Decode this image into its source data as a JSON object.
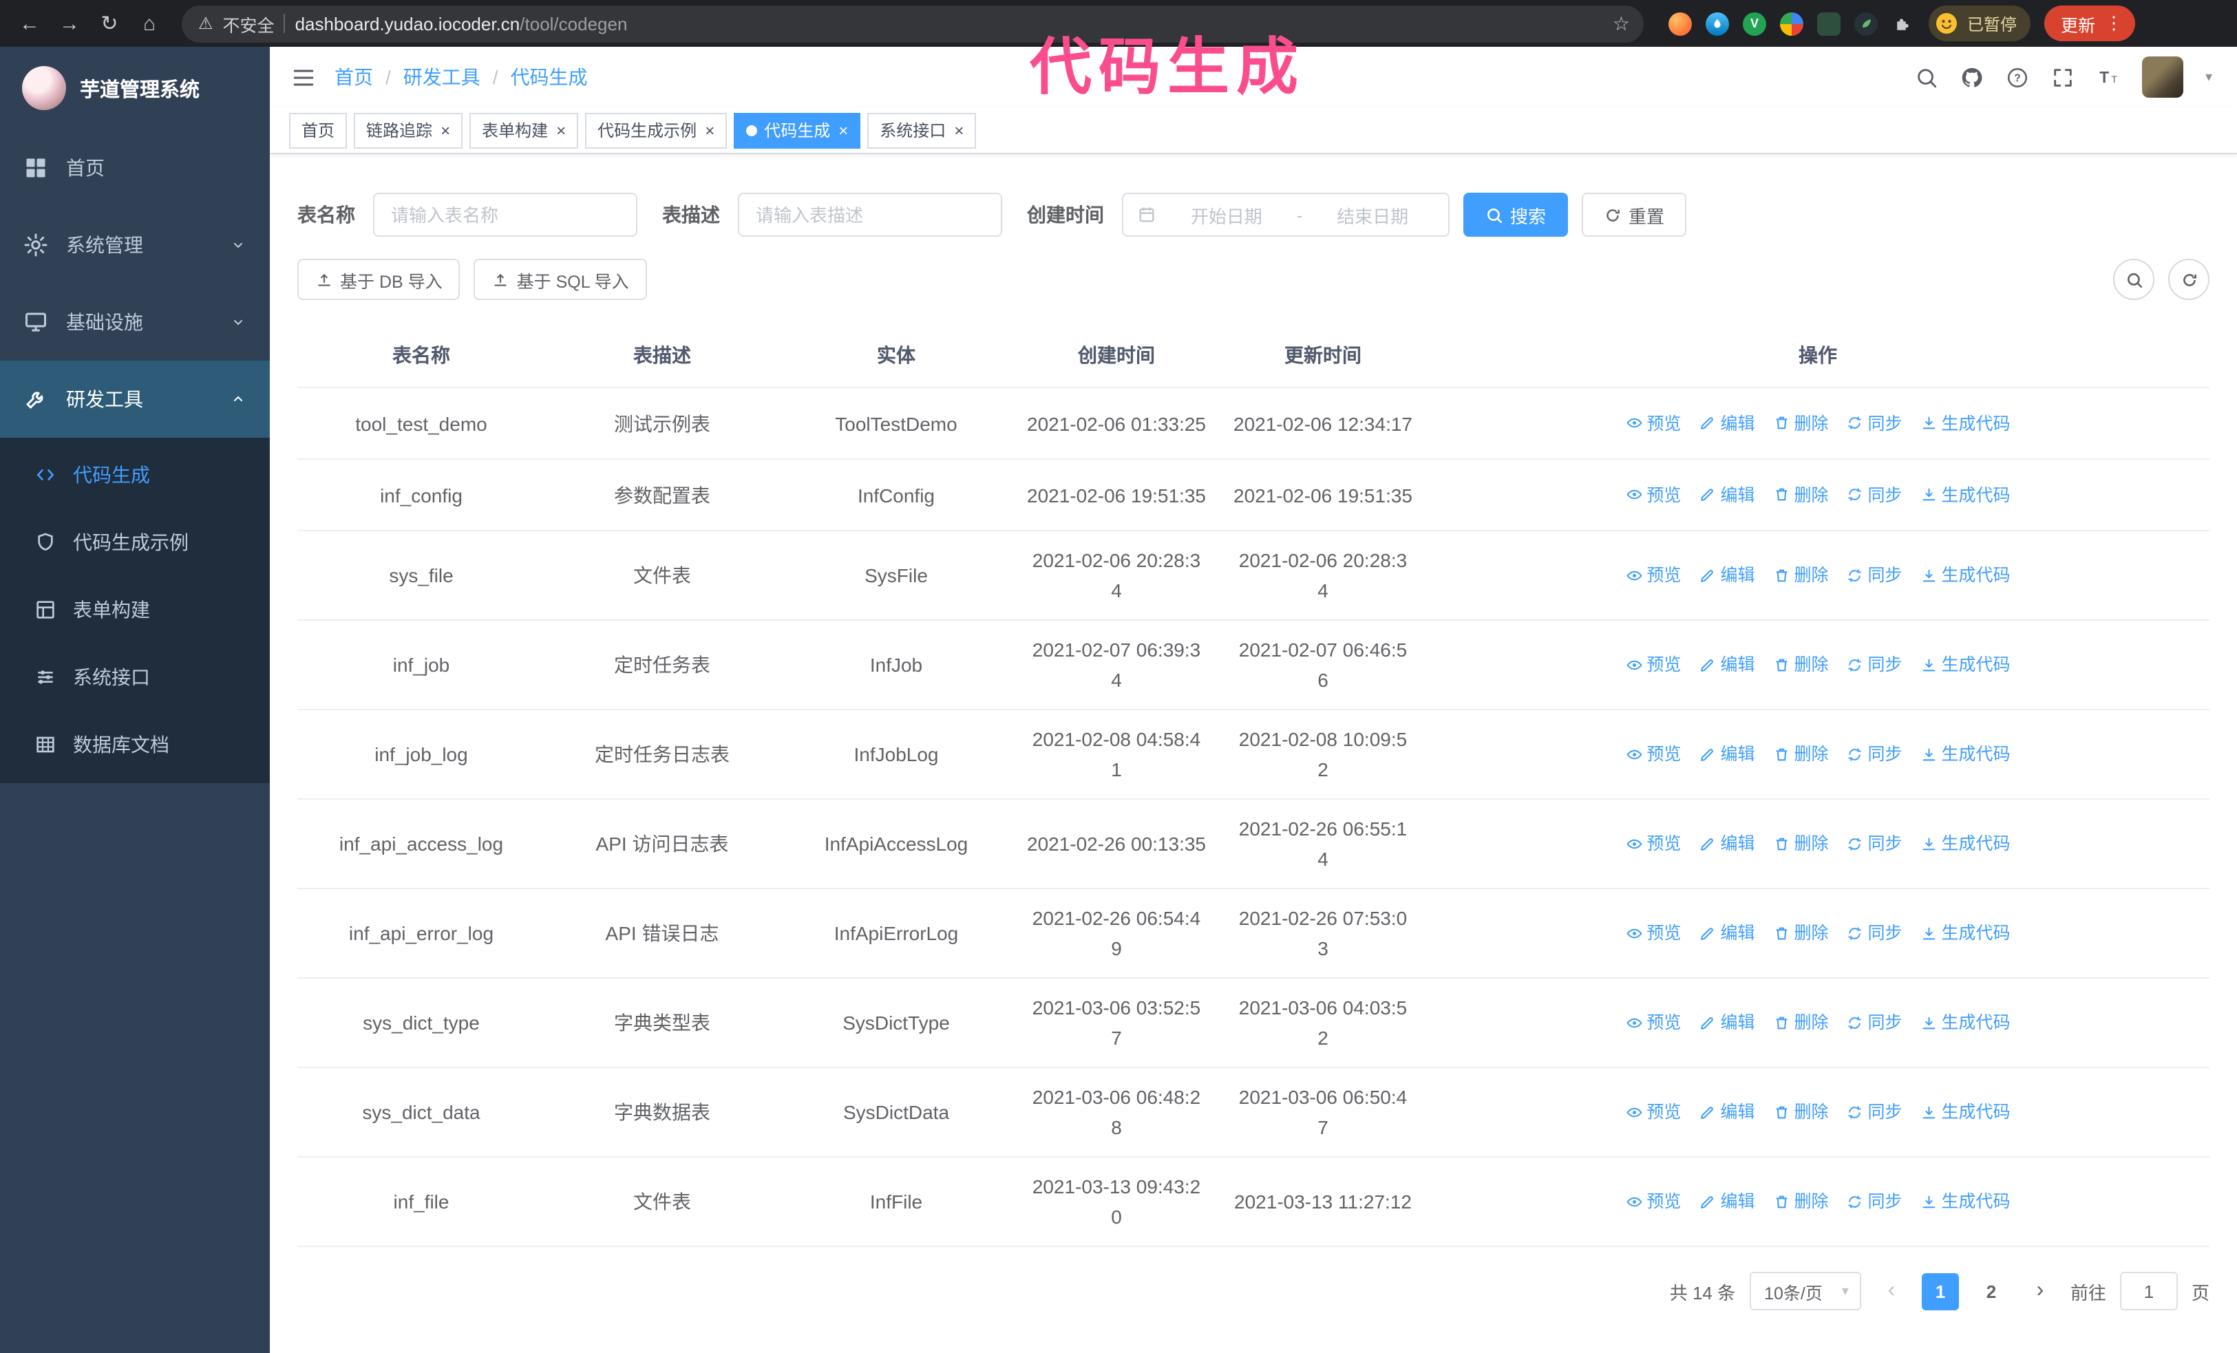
{
  "browser": {
    "security_label": "不安全",
    "url_domain": "dashboard.yudao.iocoder.cn",
    "url_path": "/tool/codegen",
    "profile_chip": "已暂停",
    "update_button": "更新"
  },
  "annotation": {
    "text": "代码生成"
  },
  "theme": {
    "primary": "#409eff",
    "sidebar_bg": "#304156",
    "submenu_bg": "#1f2d3d",
    "annotation": "#fb4d8d",
    "update_pill": "#d7432f"
  },
  "icons": {
    "back": "←",
    "forward": "→",
    "reload": "↻",
    "home": "⌂",
    "warning": "⚠",
    "star": "☆",
    "menu": "⋮",
    "ext_v": "V",
    "tab_close": "×",
    "caret_down": "▾",
    "pager_prev": "‹",
    "pager_next": "›"
  },
  "sidebar": {
    "logo_title": "芋道管理系统",
    "items": [
      {
        "label": "首页"
      },
      {
        "label": "系统管理"
      },
      {
        "label": "基础设施"
      },
      {
        "label": "研发工具"
      }
    ],
    "submenu": [
      {
        "label": "代码生成"
      },
      {
        "label": "代码生成示例"
      },
      {
        "label": "表单构建"
      },
      {
        "label": "系统接口"
      },
      {
        "label": "数据库文档"
      }
    ]
  },
  "breadcrumb": {
    "items": [
      "首页",
      "研发工具",
      "代码生成"
    ],
    "separator": "/"
  },
  "tabs": [
    {
      "label": "首页"
    },
    {
      "label": "链路追踪"
    },
    {
      "label": "表单构建"
    },
    {
      "label": "代码生成示例"
    },
    {
      "label": "代码生成"
    },
    {
      "label": "系统接口"
    }
  ],
  "filters": {
    "name_label": "表名称",
    "name_placeholder": "请输入表名称",
    "desc_label": "表描述",
    "desc_placeholder": "请输入表描述",
    "time_label": "创建时间",
    "date_start": "开始日期",
    "date_sep": "-",
    "date_end": "结束日期",
    "search": "搜索",
    "reset": "重置"
  },
  "toolbar": {
    "import_db": "基于 DB 导入",
    "import_sql": "基于 SQL 导入"
  },
  "table": {
    "headers": [
      "表名称",
      "表描述",
      "实体",
      "创建时间",
      "更新时间",
      "操作"
    ],
    "actions": [
      "预览",
      "编辑",
      "删除",
      "同步",
      "生成代码"
    ],
    "rows": [
      {
        "name": "tool_test_demo",
        "desc": "测试示例表",
        "entity": "ToolTestDemo",
        "create_time": "2021-02-06 01:33:25",
        "update_time": "2021-02-06 12:34:17"
      },
      {
        "name": "inf_config",
        "desc": "参数配置表",
        "entity": "InfConfig",
        "create_time": "2021-02-06 19:51:35",
        "update_time": "2021-02-06 19:51:35"
      },
      {
        "name": "sys_file",
        "desc": "文件表",
        "entity": "SysFile",
        "create_time": "2021-02-06 20:28:3\n4",
        "update_time": "2021-02-06 20:28:3\n4"
      },
      {
        "name": "inf_job",
        "desc": "定时任务表",
        "entity": "InfJob",
        "create_time": "2021-02-07 06:39:3\n4",
        "update_time": "2021-02-07 06:46:5\n6"
      },
      {
        "name": "inf_job_log",
        "desc": "定时任务日志表",
        "entity": "InfJobLog",
        "create_time": "2021-02-08 04:58:4\n1",
        "update_time": "2021-02-08 10:09:5\n2"
      },
      {
        "name": "inf_api_access_log",
        "desc": "API 访问日志表",
        "entity": "InfApiAccessLog",
        "create_time": "2021-02-26 00:13:35",
        "update_time": "2021-02-26 06:55:1\n4"
      },
      {
        "name": "inf_api_error_log",
        "desc": "API 错误日志",
        "entity": "InfApiErrorLog",
        "create_time": "2021-02-26 06:54:4\n9",
        "update_time": "2021-02-26 07:53:0\n3"
      },
      {
        "name": "sys_dict_type",
        "desc": "字典类型表",
        "entity": "SysDictType",
        "create_time": "2021-03-06 03:52:5\n7",
        "update_time": "2021-03-06 04:03:5\n2"
      },
      {
        "name": "sys_dict_data",
        "desc": "字典数据表",
        "entity": "SysDictData",
        "create_time": "2021-03-06 06:48:2\n8",
        "update_time": "2021-03-06 06:50:4\n7"
      },
      {
        "name": "inf_file",
        "desc": "文件表",
        "entity": "InfFile",
        "create_time": "2021-03-13 09:43:2\n0",
        "update_time": "2021-03-13 11:27:12"
      }
    ]
  },
  "pagination": {
    "total": "共 14 条",
    "page_size": "10条/页",
    "page_1": "1",
    "page_2": "2",
    "goto_label": "前往",
    "goto_value": "1",
    "goto_unit": "页"
  }
}
